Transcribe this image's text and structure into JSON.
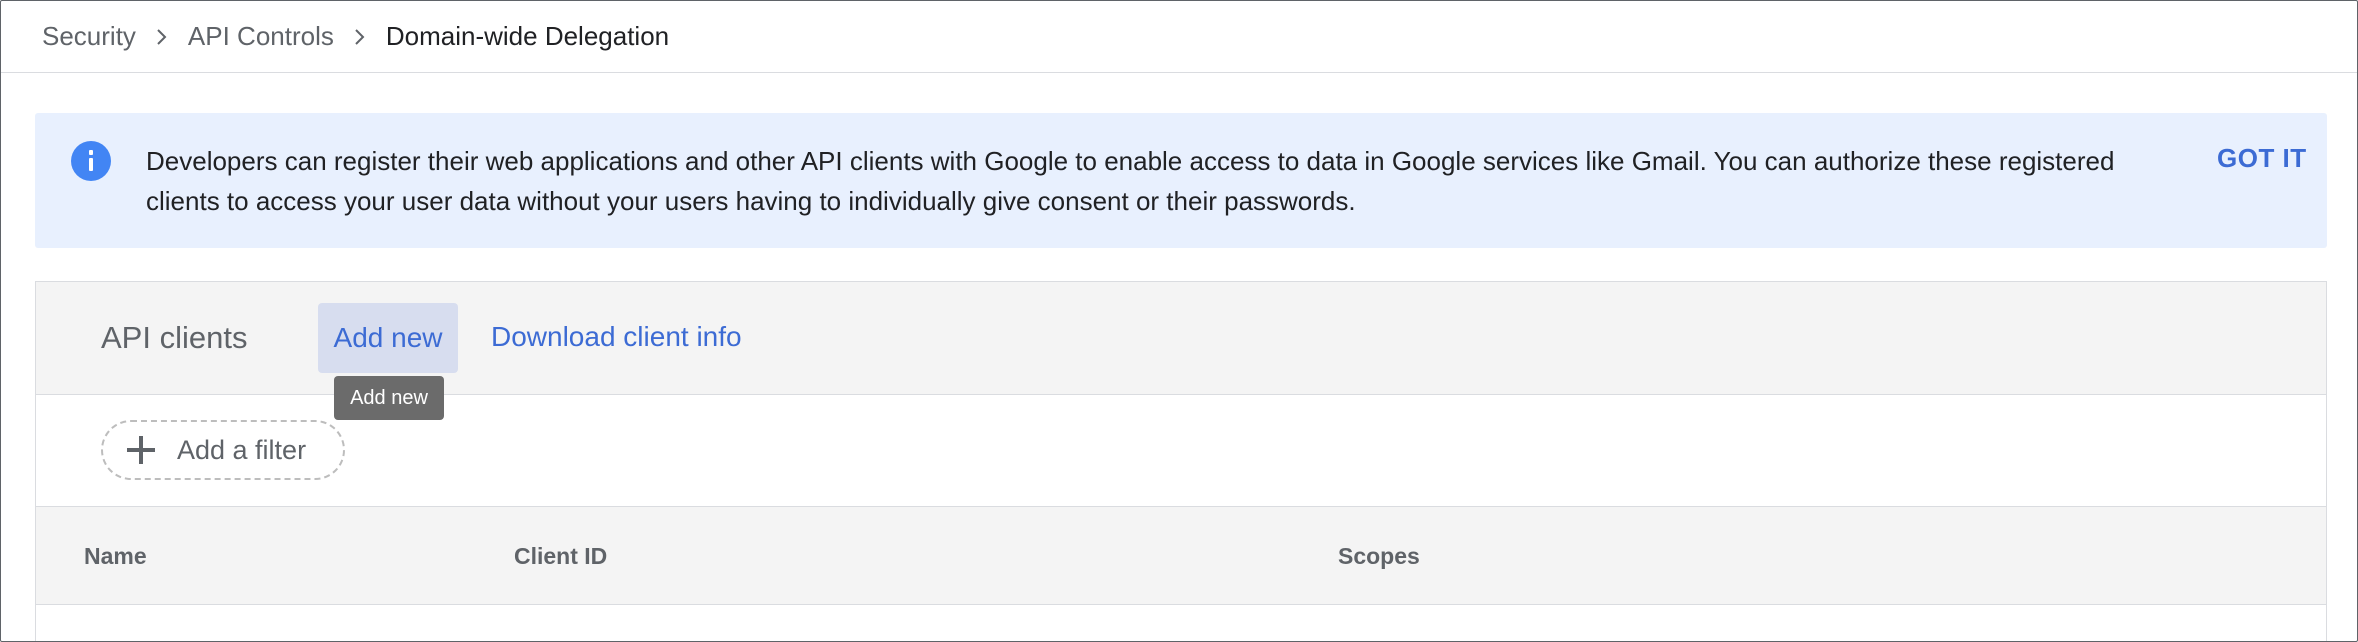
{
  "breadcrumb": {
    "items": [
      {
        "label": "Security"
      },
      {
        "label": "API Controls"
      },
      {
        "label": "Domain-wide Delegation"
      }
    ],
    "separator": ">"
  },
  "banner": {
    "icon": "info-icon",
    "text": "Developers can register their web applications and other API clients with Google to enable access to data in Google services like Gmail. You can authorize these registered clients to access your user data without your users having to individually give consent or their passwords.",
    "dismiss_label": "GOT IT"
  },
  "clients_panel": {
    "title": "API clients",
    "add_new_label": "Add new",
    "download_label": "Download client info",
    "tooltip": "Add new",
    "filter_label": "Add a filter",
    "columns": [
      "Name",
      "Client ID",
      "Scopes"
    ]
  },
  "colors": {
    "accent": "#3c6bd4",
    "banner_bg": "#e8f0fe",
    "info_icon": "#4285f4"
  }
}
